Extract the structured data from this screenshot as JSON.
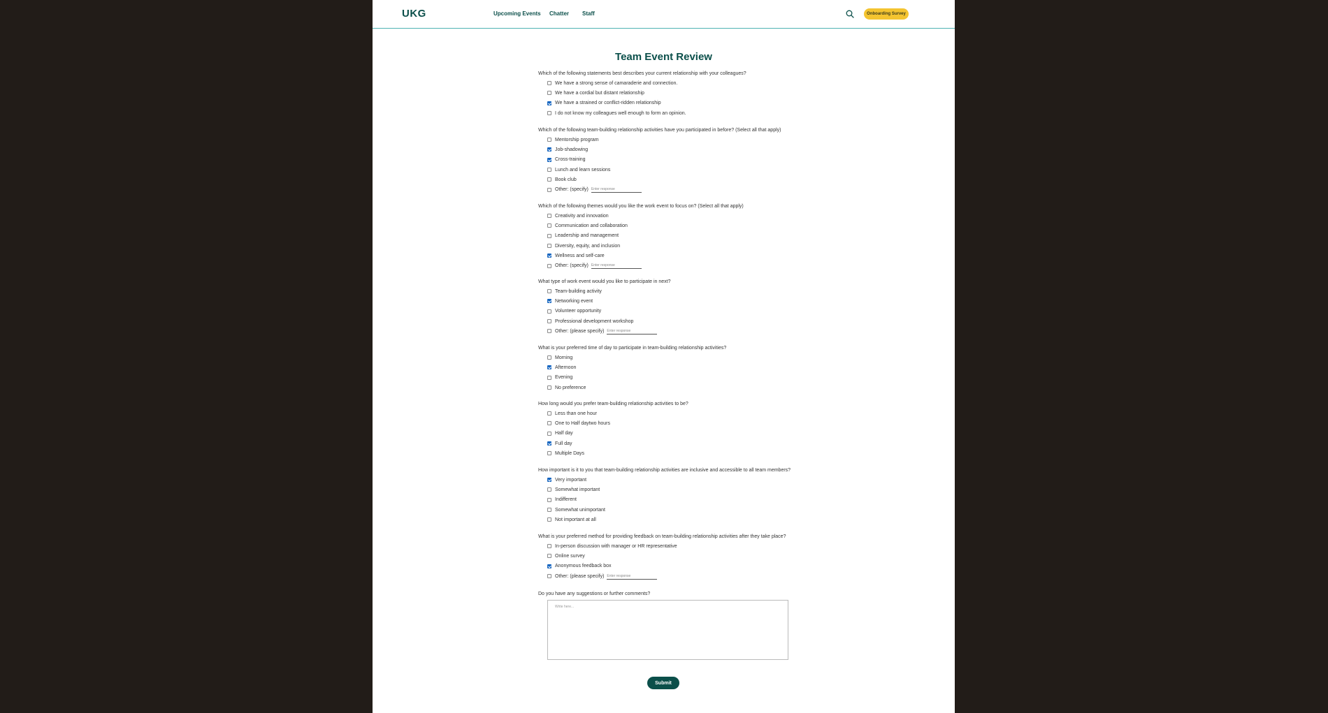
{
  "nav": {
    "logo": "UKG",
    "links": [
      "Upcoming Events",
      "Chatter",
      "Staff"
    ],
    "survey_button": "Onboarding Survey"
  },
  "title": "Team Event Review",
  "questions": [
    {
      "text": "Which of the following statements best describes your current relationship with your colleagues?",
      "options": [
        {
          "label": "We have a strong sense of camaraderie and connection.",
          "checked": false
        },
        {
          "label": "We have a cordial but distant relationship",
          "checked": false
        },
        {
          "label": "We have a strained or conflict-ridden relationship",
          "checked": true
        },
        {
          "label": "I do not know my colleagues well enough to form an opinion.",
          "checked": false
        }
      ]
    },
    {
      "text": "Which of the following team-building relationship activities have you participated in before? (Select all that apply)",
      "options": [
        {
          "label": "Mentorship program",
          "checked": false
        },
        {
          "label": "Job-shadowing",
          "checked": true
        },
        {
          "label": "Cross-training",
          "checked": true
        },
        {
          "label": "Lunch and learn sessions",
          "checked": false
        },
        {
          "label": "Book club",
          "checked": false
        },
        {
          "label": "Other: (specify)",
          "checked": false,
          "input_placeholder": "Enter response"
        }
      ]
    },
    {
      "text": "Which of the following themes would you like the work event to focus on? (Select all that apply)",
      "options": [
        {
          "label": "Creativity and innovation",
          "checked": false
        },
        {
          "label": "Communication and collaboration",
          "checked": false
        },
        {
          "label": "Leadership and management",
          "checked": false
        },
        {
          "label": "Diversity, equity, and inclusion",
          "checked": false
        },
        {
          "label": "Wellness and self-care",
          "checked": true
        },
        {
          "label": "Other: (specify)",
          "checked": false,
          "input_placeholder": "Enter response"
        }
      ]
    },
    {
      "text": "What type of work event would you like to participate in next?",
      "options": [
        {
          "label": "Team-building activity",
          "checked": false
        },
        {
          "label": "Networking event",
          "checked": true
        },
        {
          "label": "Volunteer opportunity",
          "checked": false
        },
        {
          "label": "Professional development workshop",
          "checked": false
        },
        {
          "label": "Other: (please specify)",
          "checked": false,
          "input_placeholder": "Enter response"
        }
      ]
    },
    {
      "text": "What is your preferred time of day to participate in team-building relationship activities?",
      "options": [
        {
          "label": "Morning",
          "checked": false
        },
        {
          "label": "Afternoon",
          "checked": true
        },
        {
          "label": "Evening",
          "checked": false
        },
        {
          "label": "No preference",
          "checked": false
        }
      ]
    },
    {
      "text": "How long would you prefer team-building relationship activities to be?",
      "options": [
        {
          "label": "Less than one hour",
          "checked": false
        },
        {
          "label": "One to Half daytwo hours",
          "checked": false
        },
        {
          "label": "Half day",
          "checked": false
        },
        {
          "label": "Full day",
          "checked": true
        },
        {
          "label": "Multiple Days",
          "checked": false
        }
      ]
    },
    {
      "text": "How important is it to you that team-building relationship activities are inclusive and accessible to all team members?",
      "options": [
        {
          "label": "Very important",
          "checked": true
        },
        {
          "label": "Somewhat important",
          "checked": false
        },
        {
          "label": "Indifferent",
          "checked": false
        },
        {
          "label": "Somewhat unimportant",
          "checked": false
        },
        {
          "label": "Not important at all",
          "checked": false
        }
      ]
    },
    {
      "text": "What is your preferred method for providing feedback on team-building relationship activities after they take place?",
      "options": [
        {
          "label": "In-person discussion with manager or HR representative",
          "checked": false
        },
        {
          "label": "Online survey",
          "checked": false
        },
        {
          "label": "Anonymous feedback box",
          "checked": true
        },
        {
          "label": "Other: (please specify)",
          "checked": false,
          "input_placeholder": "Enter response"
        }
      ]
    }
  ],
  "comments": {
    "question": "Do you have any suggestions or further comments?",
    "placeholder": "Write here..."
  },
  "submit_label": "Submit"
}
